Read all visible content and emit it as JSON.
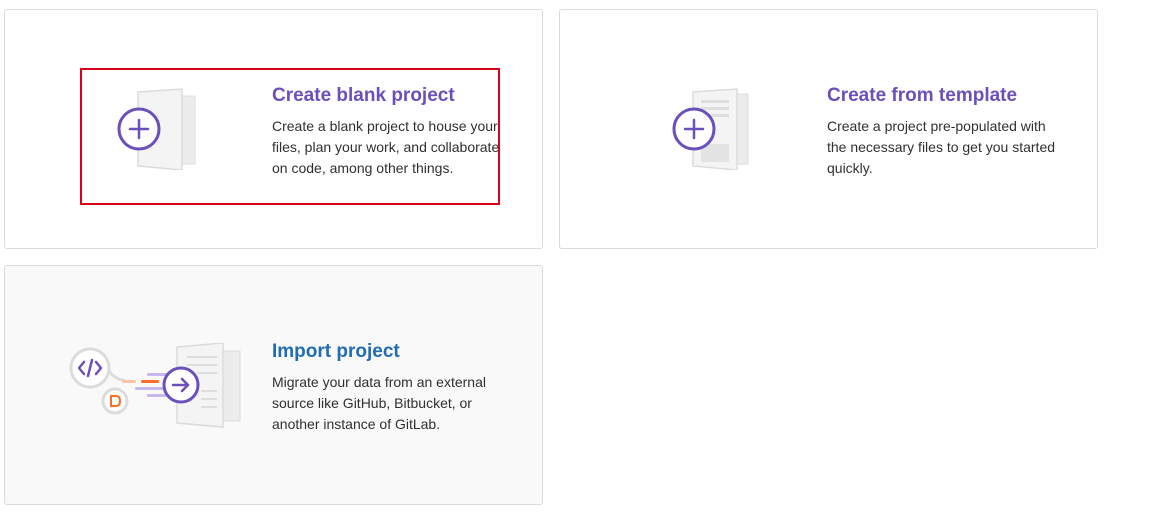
{
  "cards": {
    "blank": {
      "title": "Create blank project",
      "description": "Create a blank project to house your files, plan your work, and collaborate on code, among other things.",
      "icon": "blank-project-illustration"
    },
    "template": {
      "title": "Create from template",
      "description": "Create a project pre-populated with the necessary files to get you started quickly.",
      "icon": "template-project-illustration"
    },
    "import": {
      "title": "Import project",
      "description": "Migrate your data from an external source like GitHub, Bitbucket, or another instance of GitLab.",
      "icon": "import-project-illustration"
    }
  },
  "colors": {
    "accent_purple": "#6b4fbb",
    "accent_blue": "#1f6db3",
    "highlight_red": "#d9001b",
    "orange": "#fc6d26"
  }
}
